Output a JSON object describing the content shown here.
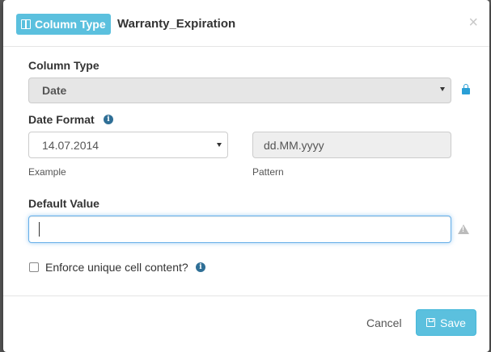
{
  "header": {
    "badge_label": "Column Type",
    "column_name": "Warranty_Expiration",
    "close_glyph": "×"
  },
  "column_type": {
    "label": "Column Type",
    "value": "Date",
    "locked": true
  },
  "date_format": {
    "label": "Date Format",
    "selected": "14.07.2014",
    "example_label": "Example",
    "pattern_value": "dd.MM.yyyy",
    "pattern_label": "Pattern"
  },
  "default_value": {
    "label": "Default Value",
    "value": ""
  },
  "enforce_unique": {
    "label": "Enforce unique cell content?",
    "checked": false
  },
  "footer": {
    "cancel_label": "Cancel",
    "save_label": "Save"
  },
  "colors": {
    "accent": "#5bc0de",
    "lock": "#2a9fd6",
    "focus_border": "#66afe9"
  },
  "icons": [
    "columns-icon",
    "close-icon",
    "lock-icon",
    "info-icon",
    "warning-icon",
    "save-icon",
    "chevron-down-icon"
  ]
}
